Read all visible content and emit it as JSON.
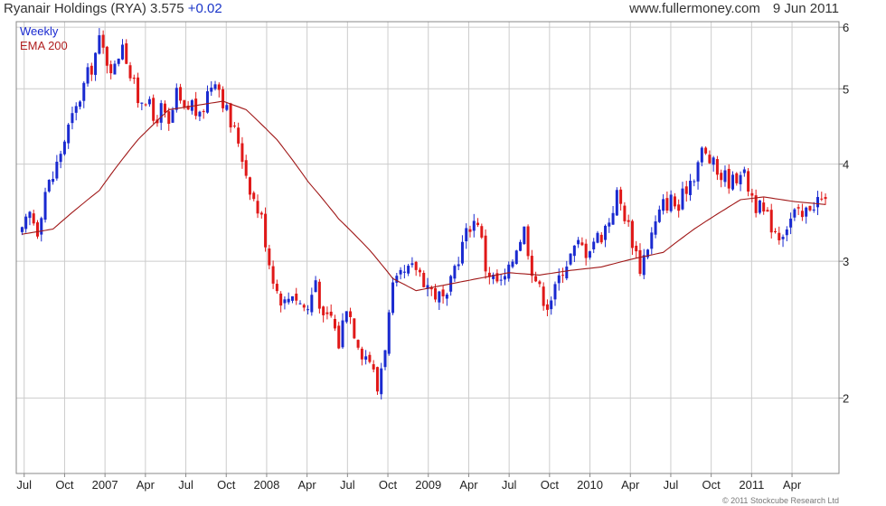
{
  "header": {
    "title": "Ryanair Holdings (RYA) 3.575",
    "change": "+0.02",
    "site": "www.fullermoney.com",
    "date": "9 Jun 2011"
  },
  "legend": {
    "weekly": "Weekly",
    "ema": "EMA 200"
  },
  "copyright": "© 2011 Stockcube Research Ltd",
  "colors": {
    "up": "#1a2ad0",
    "down": "#e01818",
    "ema": "#a01818",
    "grid": "#cccccc",
    "frame": "#888888"
  },
  "chart_data": {
    "type": "candlestick",
    "frequency": "weekly",
    "x_range": [
      "2006-06",
      "2011-06"
    ],
    "ylim": [
      1.6,
      6.1
    ],
    "y_ticks": [
      2,
      3,
      4,
      5,
      6
    ],
    "x_tick_labels": [
      {
        "label": "Jul",
        "month": 0
      },
      {
        "label": "Oct",
        "month": 3
      },
      {
        "label": "2007",
        "month": 6
      },
      {
        "label": "Apr",
        "month": 9
      },
      {
        "label": "Jul",
        "month": 12
      },
      {
        "label": "Oct",
        "month": 15
      },
      {
        "label": "2008",
        "month": 18
      },
      {
        "label": "Apr",
        "month": 21
      },
      {
        "label": "Jul",
        "month": 24
      },
      {
        "label": "Oct",
        "month": 27
      },
      {
        "label": "2009",
        "month": 30
      },
      {
        "label": "Apr",
        "month": 33
      },
      {
        "label": "Jul",
        "month": 36
      },
      {
        "label": "Oct",
        "month": 39
      },
      {
        "label": "2010",
        "month": 42
      },
      {
        "label": "Apr",
        "month": 45
      },
      {
        "label": "Jul",
        "month": 48
      },
      {
        "label": "Oct",
        "month": 51
      },
      {
        "label": "2011",
        "month": 54
      },
      {
        "label": "Apr",
        "month": 57
      }
    ],
    "close_path": [
      [
        0,
        3.25
      ],
      [
        2,
        3.45
      ],
      [
        4,
        3.3
      ],
      [
        6,
        3.7
      ],
      [
        8,
        3.85
      ],
      [
        10,
        4.15
      ],
      [
        12,
        4.45
      ],
      [
        14,
        4.7
      ],
      [
        16,
        5.05
      ],
      [
        18,
        5.35
      ],
      [
        20,
        5.75
      ],
      [
        22,
        5.45
      ],
      [
        24,
        5.3
      ],
      [
        26,
        5.8
      ],
      [
        28,
        5.2
      ],
      [
        30,
        4.85
      ],
      [
        32,
        4.9
      ],
      [
        34,
        4.55
      ],
      [
        36,
        4.7
      ],
      [
        38,
        4.45
      ],
      [
        40,
        4.9
      ],
      [
        42,
        4.65
      ],
      [
        44,
        4.8
      ],
      [
        46,
        4.55
      ],
      [
        48,
        4.95
      ],
      [
        50,
        5.2
      ],
      [
        52,
        4.85
      ],
      [
        54,
        4.5
      ],
      [
        56,
        4.3
      ],
      [
        58,
        3.9
      ],
      [
        60,
        3.6
      ],
      [
        62,
        3.4
      ],
      [
        64,
        3.0
      ],
      [
        66,
        2.75
      ],
      [
        68,
        2.65
      ],
      [
        70,
        2.75
      ],
      [
        72,
        2.65
      ],
      [
        74,
        2.6
      ],
      [
        76,
        2.85
      ],
      [
        78,
        2.5
      ],
      [
        80,
        2.55
      ],
      [
        82,
        2.35
      ],
      [
        84,
        2.65
      ],
      [
        86,
        2.45
      ],
      [
        88,
        2.3
      ],
      [
        90,
        2.25
      ],
      [
        92,
        2.05
      ],
      [
        94,
        2.35
      ],
      [
        96,
        2.75
      ],
      [
        98,
        2.85
      ],
      [
        100,
        2.9
      ],
      [
        102,
        2.95
      ],
      [
        104,
        2.85
      ],
      [
        106,
        2.75
      ],
      [
        108,
        2.7
      ],
      [
        110,
        2.65
      ],
      [
        112,
        2.95
      ],
      [
        114,
        3.15
      ],
      [
        116,
        3.35
      ],
      [
        118,
        3.4
      ],
      [
        120,
        2.95
      ],
      [
        122,
        2.85
      ],
      [
        124,
        2.8
      ],
      [
        126,
        2.9
      ],
      [
        128,
        3.15
      ],
      [
        130,
        3.3
      ],
      [
        132,
        2.95
      ],
      [
        134,
        2.75
      ],
      [
        136,
        2.65
      ],
      [
        138,
        2.75
      ],
      [
        140,
        2.95
      ],
      [
        142,
        3.05
      ],
      [
        144,
        3.15
      ],
      [
        146,
        3.1
      ],
      [
        148,
        3.2
      ],
      [
        150,
        3.25
      ],
      [
        152,
        3.4
      ],
      [
        154,
        3.65
      ],
      [
        156,
        3.45
      ],
      [
        158,
        3.2
      ],
      [
        160,
        2.95
      ],
      [
        162,
        3.15
      ],
      [
        164,
        3.35
      ],
      [
        166,
        3.55
      ],
      [
        168,
        3.6
      ],
      [
        170,
        3.5
      ],
      [
        172,
        3.75
      ],
      [
        174,
        3.9
      ],
      [
        176,
        4.15
      ],
      [
        178,
        4.05
      ],
      [
        180,
        3.9
      ],
      [
        182,
        3.85
      ],
      [
        184,
        3.8
      ],
      [
        186,
        3.95
      ],
      [
        188,
        3.75
      ],
      [
        190,
        3.55
      ],
      [
        192,
        3.45
      ],
      [
        194,
        3.35
      ],
      [
        196,
        3.25
      ],
      [
        198,
        3.35
      ],
      [
        200,
        3.45
      ],
      [
        202,
        3.4
      ],
      [
        204,
        3.55
      ],
      [
        206,
        3.6
      ],
      [
        208,
        3.575
      ]
    ],
    "ema_path": [
      [
        0,
        3.25
      ],
      [
        8,
        3.3
      ],
      [
        20,
        3.7
      ],
      [
        30,
        4.3
      ],
      [
        38,
        4.7
      ],
      [
        44,
        4.75
      ],
      [
        52,
        4.82
      ],
      [
        58,
        4.7
      ],
      [
        66,
        4.3
      ],
      [
        74,
        3.8
      ],
      [
        82,
        3.4
      ],
      [
        90,
        3.1
      ],
      [
        96,
        2.85
      ],
      [
        102,
        2.75
      ],
      [
        110,
        2.8
      ],
      [
        118,
        2.85
      ],
      [
        126,
        2.9
      ],
      [
        134,
        2.88
      ],
      [
        142,
        2.92
      ],
      [
        150,
        2.95
      ],
      [
        158,
        3.02
      ],
      [
        166,
        3.08
      ],
      [
        174,
        3.3
      ],
      [
        180,
        3.45
      ],
      [
        186,
        3.6
      ],
      [
        192,
        3.63
      ],
      [
        200,
        3.58
      ],
      [
        208,
        3.55
      ]
    ],
    "ema_label": "EMA 200",
    "series_label": "Weekly"
  }
}
